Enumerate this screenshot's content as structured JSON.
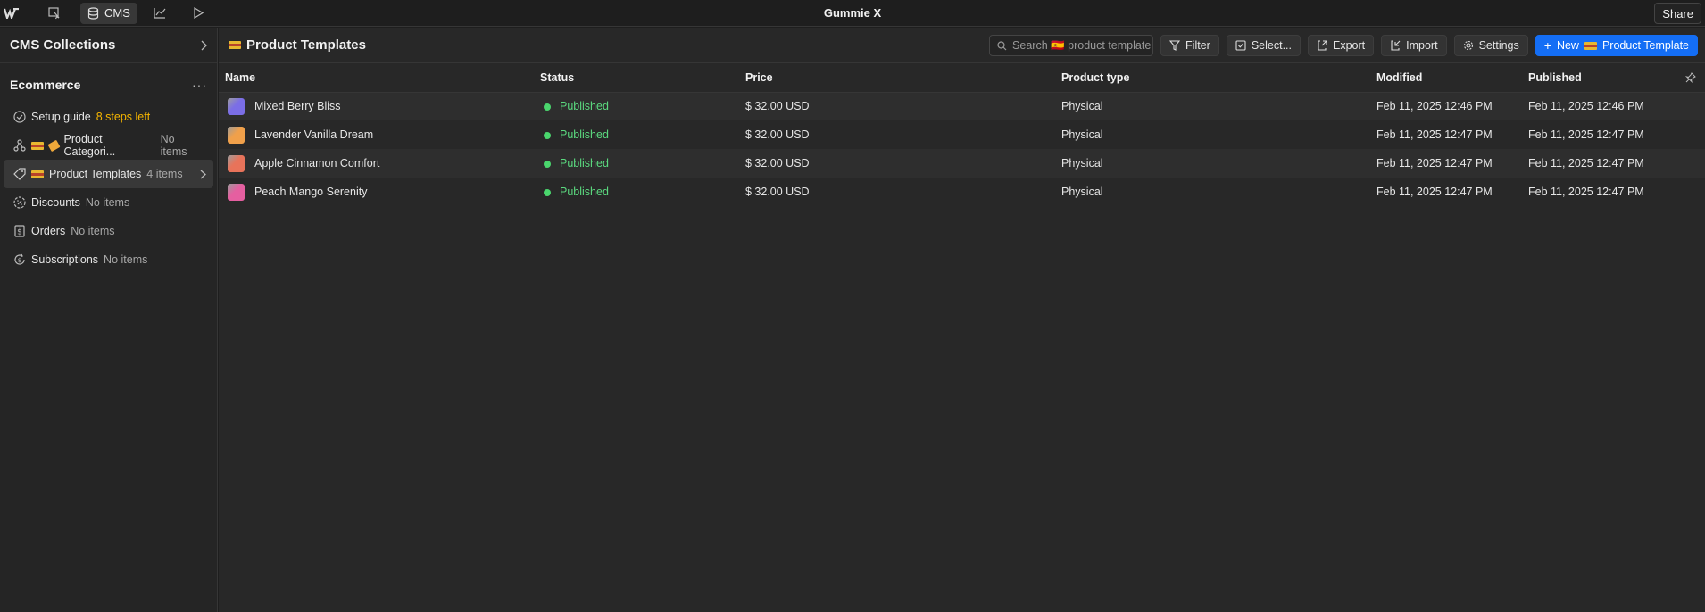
{
  "topbar": {
    "title": "Gummie X",
    "cms_label": "CMS",
    "share_label": "Share",
    "icons": [
      "webflow-logo-icon",
      "designer-cursor-icon",
      "database-icon",
      "analytics-chart-icon",
      "play-icon"
    ]
  },
  "sidebar": {
    "header": "CMS Collections",
    "section": "Ecommerce",
    "items": [
      {
        "label": "Setup guide",
        "sub": "8 steps left",
        "icon": "check-circle-icon"
      },
      {
        "label": "Product Categori...",
        "sub": "No items",
        "icon": "category-tree-icon"
      },
      {
        "label": "Product Templates",
        "sub": "4 items",
        "icon": "tag-icon"
      },
      {
        "label": "Discounts",
        "sub": "No items",
        "icon": "discount-badge-icon"
      },
      {
        "label": "Orders",
        "sub": "No items",
        "icon": "receipt-icon"
      },
      {
        "label": "Subscriptions",
        "sub": "No items",
        "icon": "subscription-icon"
      }
    ]
  },
  "main": {
    "title": "Product Templates",
    "search_placeholder": "Search 🇪🇸 product template",
    "toolbar": {
      "filter": "Filter",
      "select": "Select...",
      "export": "Export",
      "import": "Import",
      "settings": "Settings",
      "new_prefix": "New",
      "new_suffix": "Product Template"
    },
    "columns": [
      "Name",
      "Status",
      "Price",
      "Product type",
      "Modified",
      "Published"
    ],
    "rows": [
      {
        "name": "Mixed Berry Bliss",
        "status": "Published",
        "price": "$ 32.00 USD",
        "type": "Physical",
        "modified": "Feb 11, 2025 12:46 PM",
        "published": "Feb 11, 2025 12:46 PM",
        "thumb_color": "#7b6ee6"
      },
      {
        "name": "Lavender Vanilla Dream",
        "status": "Published",
        "price": "$ 32.00 USD",
        "type": "Physical",
        "modified": "Feb 11, 2025 12:47 PM",
        "published": "Feb 11, 2025 12:47 PM",
        "thumb_color": "#f0a04a"
      },
      {
        "name": "Apple Cinnamon Comfort",
        "status": "Published",
        "price": "$ 32.00 USD",
        "type": "Physical",
        "modified": "Feb 11, 2025 12:47 PM",
        "published": "Feb 11, 2025 12:47 PM",
        "thumb_color": "#e8735a"
      },
      {
        "name": "Peach Mango Serenity",
        "status": "Published",
        "price": "$ 32.00 USD",
        "type": "Physical",
        "modified": "Feb 11, 2025 12:47 PM",
        "published": "Feb 11, 2025 12:47 PM",
        "thumb_color": "#e55fa0"
      }
    ]
  },
  "colors": {
    "accent": "#146ef5",
    "published": "#5bd97f",
    "warning": "#f5b500"
  }
}
